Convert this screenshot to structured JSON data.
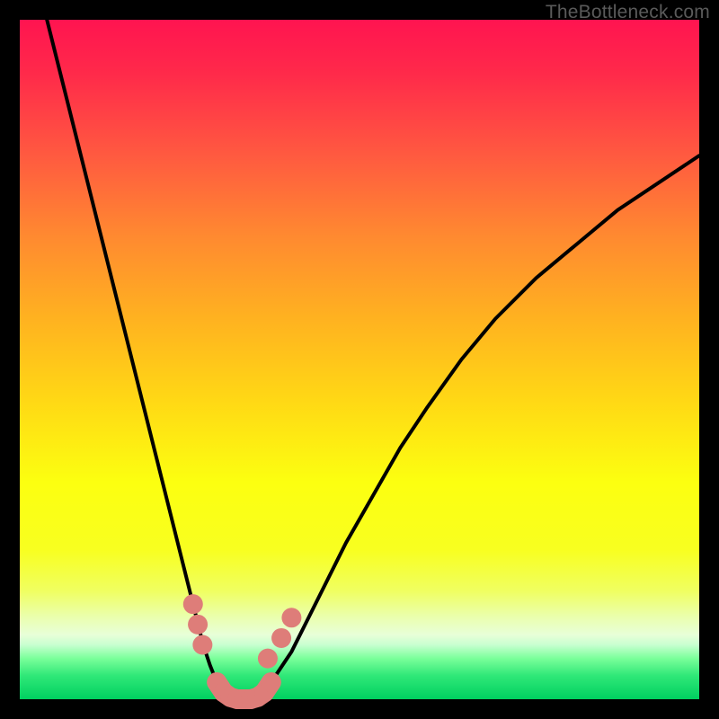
{
  "watermark": "TheBottleneck.com",
  "chart_data": {
    "type": "line",
    "title": "",
    "xlabel": "",
    "ylabel": "",
    "xlim": [
      0,
      100
    ],
    "ylim": [
      0,
      100
    ],
    "series": [
      {
        "name": "left-curve",
        "x": [
          4,
          6,
          8,
          10,
          12,
          14,
          16,
          18,
          20,
          22,
          24,
          26,
          27,
          28,
          29,
          30,
          31
        ],
        "y": [
          100,
          92,
          84,
          76,
          68,
          60,
          52,
          44,
          36,
          28,
          20,
          12,
          8,
          5,
          2.5,
          1,
          0
        ]
      },
      {
        "name": "right-curve",
        "x": [
          35,
          36,
          37,
          38,
          40,
          42,
          45,
          48,
          52,
          56,
          60,
          65,
          70,
          76,
          82,
          88,
          94,
          100
        ],
        "y": [
          0,
          1,
          2.5,
          4,
          7,
          11,
          17,
          23,
          30,
          37,
          43,
          50,
          56,
          62,
          67,
          72,
          76,
          80
        ]
      },
      {
        "name": "bottom-connector",
        "x": [
          29,
          30,
          31,
          32,
          33,
          34,
          35,
          36,
          37
        ],
        "y": [
          2.5,
          1,
          0.3,
          0,
          0,
          0,
          0.3,
          1,
          2.5
        ]
      }
    ],
    "markers": {
      "name": "highlight-dots",
      "color": "#de7d79",
      "points": [
        {
          "x": 25.5,
          "y": 14
        },
        {
          "x": 26.2,
          "y": 11
        },
        {
          "x": 26.9,
          "y": 8
        },
        {
          "x": 29.0,
          "y": 2.5
        },
        {
          "x": 30.0,
          "y": 1.0
        },
        {
          "x": 31.0,
          "y": 0.3
        },
        {
          "x": 32.0,
          "y": 0.0
        },
        {
          "x": 33.0,
          "y": 0.0
        },
        {
          "x": 34.0,
          "y": 0.0
        },
        {
          "x": 35.0,
          "y": 0.3
        },
        {
          "x": 36.0,
          "y": 1.0
        },
        {
          "x": 37.0,
          "y": 2.5
        },
        {
          "x": 36.5,
          "y": 6
        },
        {
          "x": 38.5,
          "y": 9
        },
        {
          "x": 40.0,
          "y": 12
        }
      ]
    },
    "background_gradient": {
      "top": "#ff1450",
      "mid": "#fcff10",
      "bottom": "#00d060"
    }
  }
}
